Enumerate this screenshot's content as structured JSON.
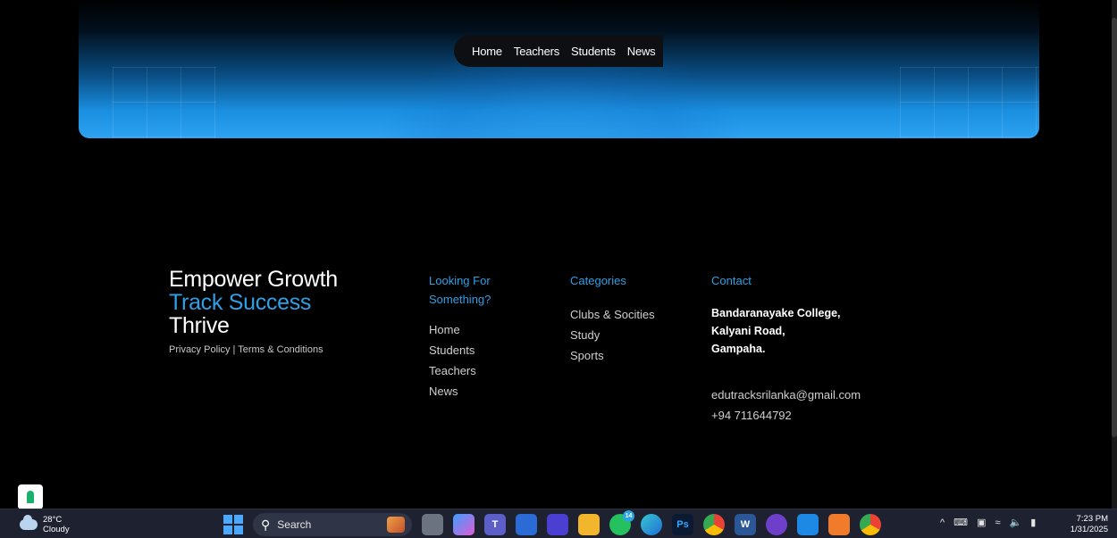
{
  "nav": {
    "items": [
      "Home",
      "Teachers",
      "Students",
      "News"
    ]
  },
  "brand": {
    "line1": "Empower Growth",
    "line2": "Track Success",
    "line3": "Thrive",
    "legal": "Privacy Policy | Terms & Conditions"
  },
  "footer": {
    "looking": {
      "heading": "Looking For Something?",
      "items": [
        "Home",
        "Students",
        "Teachers",
        "News"
      ]
    },
    "categories": {
      "heading": "Categories",
      "items": [
        "Clubs & Socities",
        "Study",
        "Sports"
      ]
    },
    "contact": {
      "heading": "Contact",
      "address": [
        "Bandaranayake College,",
        "Kalyani Road,",
        "Gampaha."
      ],
      "email": "edutracksrilanka@gmail.com",
      "phone": "+94 711644792"
    }
  },
  "taskbar": {
    "weather": {
      "temp": "28°C",
      "condition": "Cloudy"
    },
    "search_label": "Search",
    "whatsapp_badge": "14",
    "time": "7:23 PM",
    "date": "1/31/2025"
  },
  "colors": {
    "accent": "#2f9fe6",
    "background": "#000000",
    "taskbar": "#1d2130"
  }
}
